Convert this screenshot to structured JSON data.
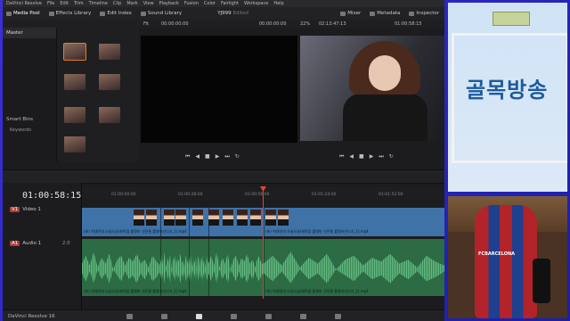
{
  "menu": [
    "DaVinci Resolve",
    "File",
    "Edit",
    "Trim",
    "Timeline",
    "Clip",
    "Mark",
    "View",
    "Playback",
    "Fusion",
    "Color",
    "Fairlight",
    "Workspace",
    "Help"
  ],
  "toolbar": {
    "media_pool": "Media Pool",
    "effects_library": "Effects Library",
    "edit_index": "Edit Index",
    "sound_library": "Sound Library",
    "project_title": "YJ999",
    "edited": "Edited",
    "mixer": "Mixer",
    "metadata": "Metadata",
    "inspector": "Inspector"
  },
  "viewer": {
    "fit": "Fit",
    "source_tc": "00:00:00:00",
    "duration": "00:00:00:00",
    "zoom": "22%",
    "program_duration": "02:13:47:13",
    "program_tc": "01:00:58:15"
  },
  "bins": {
    "master": "Master",
    "smart_bins": "Smart Bins",
    "keywords": "Keywords"
  },
  "timeline": {
    "timecode": "01:00:58:15",
    "ruler": [
      "01:00:00:00",
      "01:00:28:00",
      "01:00:56:00",
      "01:01:24:00",
      "01:01:52:00"
    ],
    "video_track": "Video 1",
    "video_badge": "V1",
    "audio_track": "Audio 1",
    "audio_badge": "A1",
    "audio_channels": "2.0",
    "clip_name": "(초) 허대전대 오글오글(회목옵 롤짱마 선전들 롤짱마신디기_1].mp4"
  },
  "bottombar": {
    "app_name": "DaVinci Resolve 16"
  },
  "right_panel": {
    "sign_text": "골목방송",
    "chair_text": "FCBARCELONA"
  }
}
